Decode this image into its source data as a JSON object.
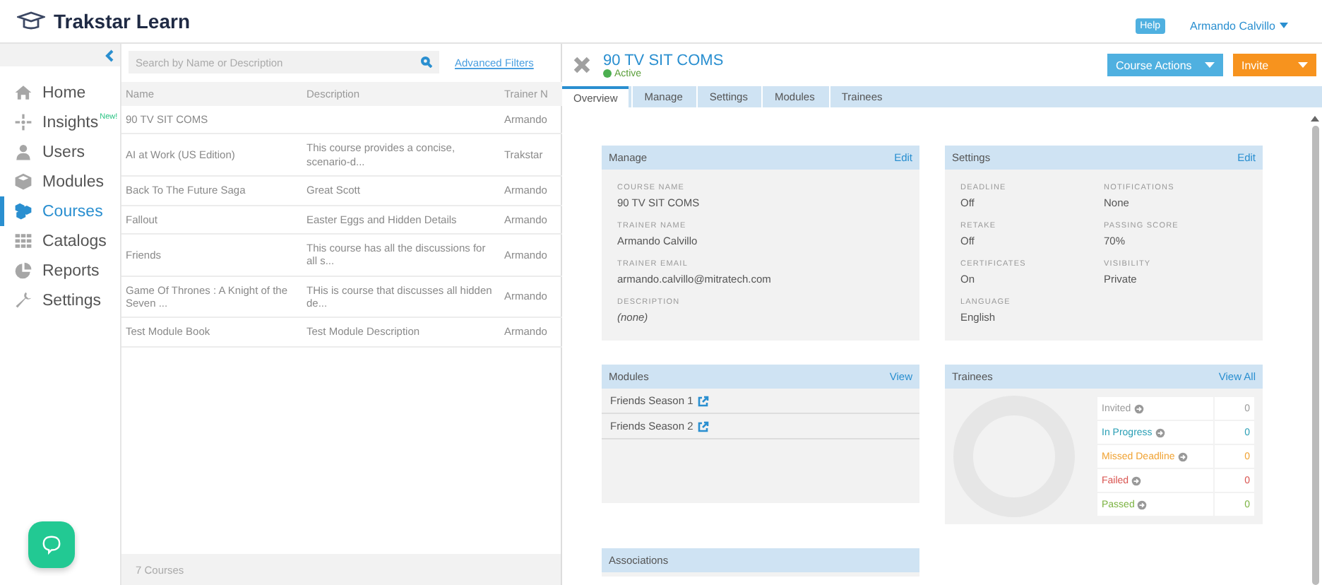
{
  "header": {
    "brand": "Trakstar Learn",
    "help": "Help",
    "user": "Armando Calvillo"
  },
  "sidebar": {
    "items": [
      {
        "kind": "home",
        "label": "Home",
        "selected": false
      },
      {
        "kind": "insights",
        "label": "Insights",
        "badge": "New!",
        "selected": false
      },
      {
        "kind": "users",
        "label": "Users",
        "selected": false
      },
      {
        "kind": "modules",
        "label": "Modules",
        "selected": false
      },
      {
        "kind": "courses",
        "label": "Courses",
        "selected": true
      },
      {
        "kind": "catalogs",
        "label": "Catalogs",
        "selected": false
      },
      {
        "kind": "reports",
        "label": "Reports",
        "selected": false
      },
      {
        "kind": "settings",
        "label": "Settings",
        "selected": false
      }
    ]
  },
  "course_list": {
    "search": {
      "placeholder": "Search by Name or Description"
    },
    "advanced_filters": "Advanced Filters",
    "columns": [
      "Name",
      "Description",
      "Trainer N"
    ],
    "rows": [
      {
        "name": "90 TV SIT COMS",
        "description": "",
        "trainer": "Armando",
        "selected": false
      },
      {
        "name": "AI at Work (US Edition)",
        "description": "This course provides a concise, scenario-d...",
        "trainer": "Trakstar",
        "selected": false
      },
      {
        "name": "Back To The Future Saga",
        "description": "Great Scott",
        "trainer": "Armando",
        "selected": false
      },
      {
        "name": "Fallout",
        "description": "Easter Eggs and Hidden Details",
        "trainer": "Armando",
        "selected": false
      },
      {
        "name": "Friends",
        "description": "This course has all the discussions for all s...",
        "trainer": "Armando",
        "selected": false
      },
      {
        "name": "Game Of Thrones : A Knight of the Seven ...",
        "description": "THis is course that discusses all hidden de...",
        "trainer": "Armando",
        "selected": false
      },
      {
        "name": "Test Module Book",
        "description": "Test Module Description",
        "trainer": "Armando",
        "selected": false
      }
    ],
    "footer": "7 Courses"
  },
  "course": {
    "title": "90 TV SIT COMS",
    "status": "Active",
    "actions": [
      {
        "kind": "primary",
        "label": "Course Actions"
      },
      {
        "kind": "warning",
        "label": "Invite"
      }
    ],
    "tabs": [
      {
        "label": "Overview",
        "selected": true
      },
      {
        "label": "Manage",
        "selected": false
      },
      {
        "label": "Settings",
        "selected": false
      },
      {
        "label": "Modules",
        "selected": false
      },
      {
        "label": "Trainees",
        "selected": false
      }
    ],
    "manage": {
      "title": "Manage",
      "action": "Edit",
      "fields": [
        {
          "label": "COURSE NAME",
          "value": "90 TV SIT COMS",
          "empty": false
        },
        {
          "label": "TRAINER NAME",
          "value": "Armando Calvillo",
          "empty": false
        },
        {
          "label": "TRAINER EMAIL",
          "value": "armando.calvillo@mitratech.com",
          "empty": false
        },
        {
          "label": "DESCRIPTION",
          "value": "(none)",
          "empty": true
        }
      ]
    },
    "settings": {
      "title": "Settings",
      "action": "Edit",
      "fields": [
        {
          "label": "DEADLINE",
          "value": "Off"
        },
        {
          "label": "NOTIFICATIONS",
          "value": "None"
        },
        {
          "label": "RETAKE",
          "value": "Off"
        },
        {
          "label": "PASSING SCORE",
          "value": "70%"
        },
        {
          "label": "CERTIFICATES",
          "value": "On"
        },
        {
          "label": "VISIBILITY",
          "value": "Private"
        },
        {
          "label": "LANGUAGE",
          "value": "English"
        }
      ]
    },
    "modules": {
      "title": "Modules",
      "action": "View",
      "items": [
        "Friends Season 1",
        "Friends Season 2"
      ]
    },
    "trainees": {
      "title": "Trainees",
      "action": "View All",
      "statuses": [
        {
          "label": "Invited",
          "count": "0",
          "color": "#9a9a9a"
        },
        {
          "label": "In Progress",
          "count": "0",
          "color": "#2a9fb5"
        },
        {
          "label": "Missed Deadline",
          "count": "0",
          "color": "#f0a232"
        },
        {
          "label": "Failed",
          "count": "0",
          "color": "#d9534f"
        },
        {
          "label": "Passed",
          "count": "0",
          "color": "#7cb342"
        }
      ]
    },
    "associations": {
      "title": "Associations"
    }
  }
}
